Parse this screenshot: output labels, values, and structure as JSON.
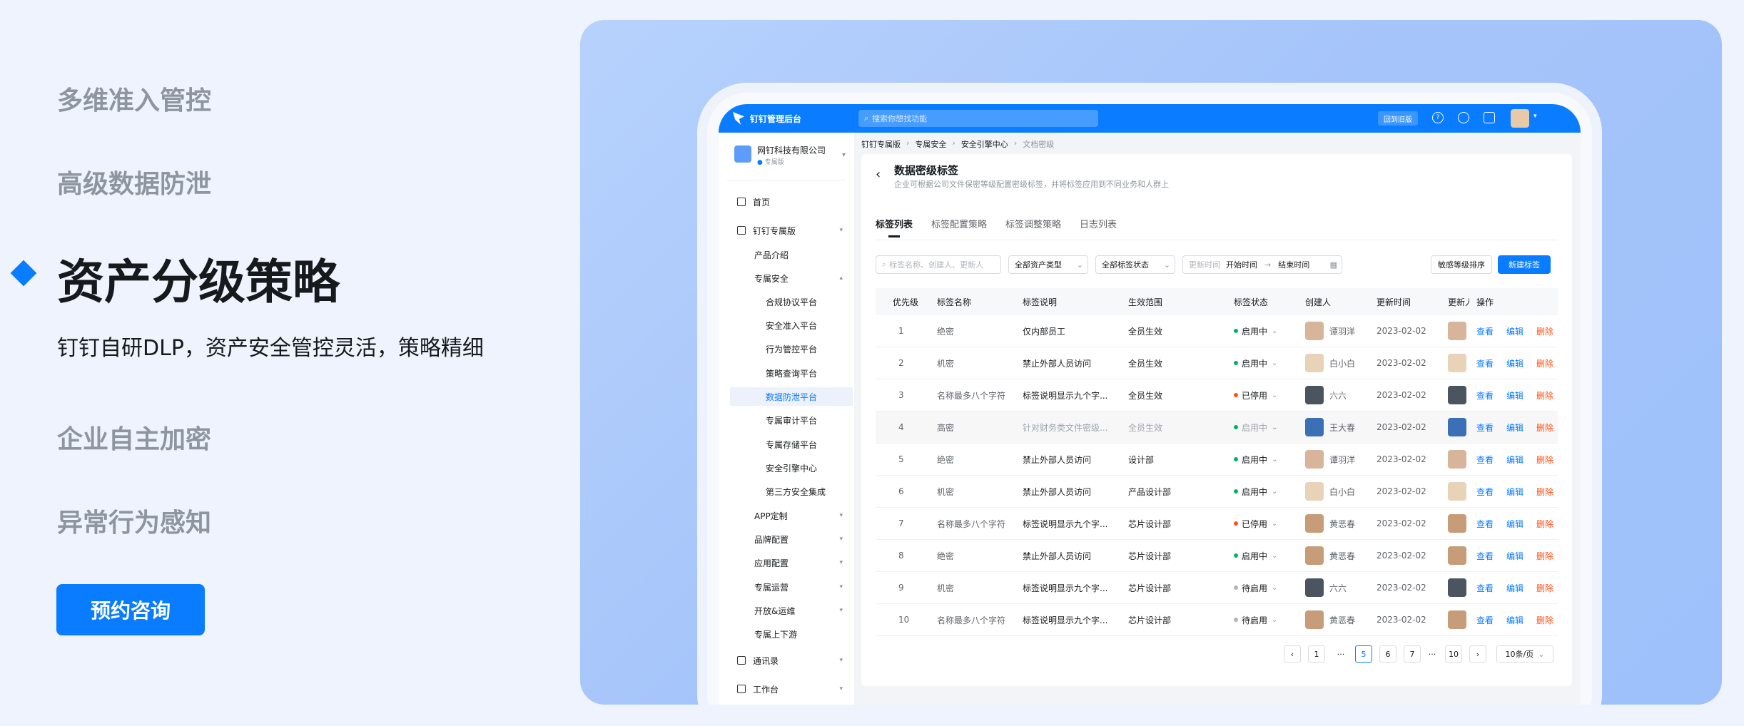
{
  "features": {
    "item1": "多维准入管控",
    "item2": "高级数据防泄",
    "active_title": "资产分级策略",
    "active_desc": "钉钉自研DLP，资产安全管控灵活，策略精细",
    "item4": "企业自主加密",
    "item5": "异常行为感知",
    "cta": "预约咨询"
  },
  "app": {
    "brand": "钉钉管理后台",
    "search_placeholder": "搜索你想找功能",
    "back_btn": "回到旧版",
    "help_icon": "?",
    "org_name": "网钉科技有限公司",
    "org_tag": "专属版"
  },
  "sidebar": {
    "items": [
      {
        "label": "首页",
        "icon": "home-icon"
      },
      {
        "label": "钉钉专属版",
        "icon": "cube-icon"
      },
      {
        "label": "产品介绍"
      },
      {
        "label": "专属安全"
      },
      {
        "label": "合规协议平台"
      },
      {
        "label": "安全准入平台"
      },
      {
        "label": "行为管控平台"
      },
      {
        "label": "策略查询平台"
      },
      {
        "label": "数据防泄平台"
      },
      {
        "label": "专属审计平台"
      },
      {
        "label": "专属存储平台"
      },
      {
        "label": "安全引擎中心"
      },
      {
        "label": "第三方安全集成"
      },
      {
        "label": "APP定制"
      },
      {
        "label": "品牌配置"
      },
      {
        "label": "应用配置"
      },
      {
        "label": "专属运营"
      },
      {
        "label": "开放&运维"
      },
      {
        "label": "专属上下游"
      },
      {
        "label": "通讯录",
        "icon": "contacts-icon"
      },
      {
        "label": "工作台",
        "icon": "workbench-icon"
      }
    ]
  },
  "breadcrumb": [
    "钉钉专属版",
    "专属安全",
    "安全引擎中心",
    "文档密级"
  ],
  "page": {
    "title": "数据密级标签",
    "subtitle": "企业可根据公司文件保密等级配置密级标签，并将标签应用到不同业务和人群上",
    "tabs": [
      "标签列表",
      "标签配置策略",
      "标签调整策略",
      "日志列表"
    ]
  },
  "filters": {
    "search_placeholder": "标签名称、创建人、更新人",
    "asset_type": "全部资产类型",
    "tag_status": "全部标签状态",
    "time_label": "更新时间",
    "start": "开始时间",
    "arrow": "→",
    "end": "结束时间",
    "sort_btn": "敏感等级排序",
    "new_btn": "新建标签"
  },
  "table": {
    "headers": [
      "优先级",
      "标签名称",
      "标签说明",
      "生效范围",
      "标签状态",
      "创建人",
      "更新时间",
      "更新人",
      "操作"
    ],
    "actions": [
      "查看",
      "编辑",
      "删除"
    ],
    "rows": [
      {
        "p": "1",
        "name": "绝密",
        "desc": "仅内部员工",
        "scope": "全员生效",
        "status": "启用中",
        "status_color": "#00b365",
        "creator": "谭羽洋",
        "time": "2023-02-02"
      },
      {
        "p": "2",
        "name": "机密",
        "desc": "禁止外部人员访问",
        "scope": "全员生效",
        "status": "启用中",
        "status_color": "#00b365",
        "creator": "白小白",
        "time": "2023-02-02"
      },
      {
        "p": "3",
        "name": "名称最多八个字符",
        "desc": "标签说明显示九个字...",
        "scope": "全员生效",
        "status": "已停用",
        "status_color": "#ff5219",
        "creator": "六六",
        "time": "2023-02-02"
      },
      {
        "p": "4",
        "name": "高密",
        "desc": "针对财务类文件密级...",
        "scope": "全员生效",
        "status": "启用中",
        "status_color": "#00b365",
        "creator": "王大春",
        "time": "2023-02-02"
      },
      {
        "p": "5",
        "name": "绝密",
        "desc": "禁止外部人员访问",
        "scope": "设计部",
        "status": "启用中",
        "status_color": "#00b365",
        "creator": "谭羽洋",
        "time": "2023-02-02"
      },
      {
        "p": "6",
        "name": "机密",
        "desc": "禁止外部人员访问",
        "scope": "产品设计部",
        "status": "启用中",
        "status_color": "#00b365",
        "creator": "白小白",
        "time": "2023-02-02"
      },
      {
        "p": "7",
        "name": "名称最多八个字符",
        "desc": "标签说明显示九个字...",
        "scope": "芯片设计部",
        "status": "已停用",
        "status_color": "#ff5219",
        "creator": "黄恶春",
        "time": "2023-02-02"
      },
      {
        "p": "8",
        "name": "绝密",
        "desc": "禁止外部人员访问",
        "scope": "芯片设计部",
        "status": "启用中",
        "status_color": "#00b365",
        "creator": "黄恶春",
        "time": "2023-02-02"
      },
      {
        "p": "9",
        "name": "机密",
        "desc": "标签说明显示九个字...",
        "scope": "芯片设计部",
        "status": "待启用",
        "status_color": "#b0b4ba",
        "creator": "六六",
        "time": "2023-02-02"
      },
      {
        "p": "10",
        "name": "名称最多八个字符",
        "desc": "标签说明显示九个字...",
        "scope": "芯片设计部",
        "status": "待启用",
        "status_color": "#b0b4ba",
        "creator": "黄恶春",
        "time": "2023-02-02"
      }
    ]
  },
  "pagination": {
    "pages": [
      "1",
      "5",
      "6",
      "7",
      "10"
    ],
    "ellipsis": "···",
    "current": "5",
    "page_size": "10条/页"
  }
}
